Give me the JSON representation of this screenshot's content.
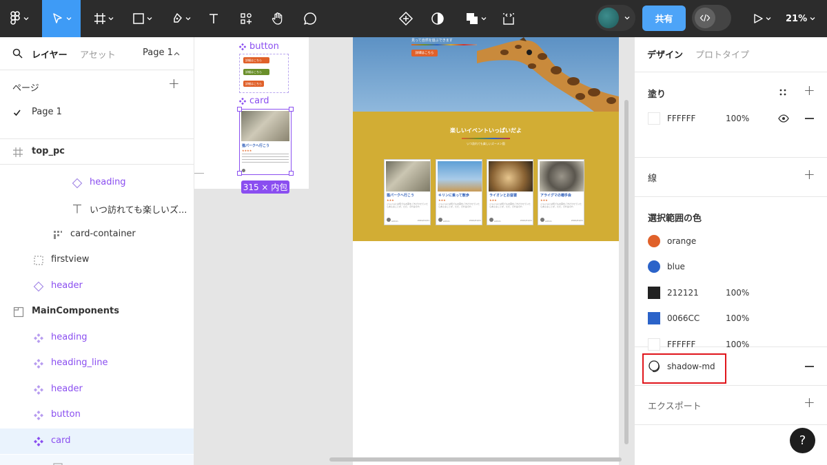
{
  "toolbar": {
    "zoom": "21%",
    "share_label": "共有"
  },
  "left_panel": {
    "tabs": {
      "layers": "レイヤー",
      "assets": "アセット",
      "page": "Page 1"
    },
    "pages_title": "ページ",
    "current_page": "Page 1",
    "layers": [
      {
        "label": "top_pc",
        "icon": "frame-icon"
      },
      {
        "label": "heading",
        "icon": "instance-icon"
      },
      {
        "label": "いつ訪れても楽しいズ...",
        "icon": "text-icon"
      },
      {
        "label": "card-container",
        "icon": "autolayout-grid-icon"
      },
      {
        "label": "firstview",
        "icon": "group-icon"
      },
      {
        "label": "header",
        "icon": "instance-icon"
      },
      {
        "label": "MainComponents",
        "icon": "section-icon"
      },
      {
        "label": "heading",
        "icon": "component-icon"
      },
      {
        "label": "heading_line",
        "icon": "component-icon"
      },
      {
        "label": "header",
        "icon": "component-icon"
      },
      {
        "label": "button",
        "icon": "component-icon"
      },
      {
        "label": "card",
        "icon": "component-icon"
      }
    ]
  },
  "canvas": {
    "button_component_label": "button",
    "card_component_label": "card",
    "selection_size": "315 × 内包",
    "mini_button_text": "詳細はこちら",
    "mini_card": {
      "title": "猫パークへ行こう",
      "stars": "★★★★"
    },
    "hero": {
      "small_text": "見って自然を遊ぶできます",
      "button": "詳細はこちら"
    },
    "events": {
      "title": "楽しいイベントいっぱいだよ",
      "subtitle": "いつ訪れても楽しいズーメン園",
      "cards": [
        {
          "title": "猫パークへ行こう",
          "stars": "★★★",
          "text": "ジョジョには何でもお茶をごきげさせていたらあんなことが、ただ、それはそれ",
          "author": "Admin",
          "date": "2024/01/01"
        },
        {
          "title": "キリンに乗って散歩",
          "stars": "★★★",
          "text": "ジョジョには何でもお茶をごきげさせていたらあんなことが、ただ、それはそれ",
          "author": "Admin",
          "date": "2024/01/01"
        },
        {
          "title": "ライオンとお昼寝",
          "stars": "★★★",
          "text": "ジョジョには何でもお茶をごきげさせていたらあんなことが、ただ、それはそれ",
          "author": "Admin",
          "date": "2024/01/01"
        },
        {
          "title": "アライグマの柵手会",
          "stars": "★★★",
          "text": "ジョジョには何でもお茶をごきげさせていたらあんなことが、ただ、それはそれ",
          "author": "Admin",
          "date": "2024/01/01"
        }
      ]
    }
  },
  "right_panel": {
    "tabs": {
      "design": "デザイン",
      "prototype": "プロトタイプ"
    },
    "fill": {
      "title": "塗り",
      "hex": "FFFFFF",
      "opacity": "100%"
    },
    "stroke": {
      "title": "線"
    },
    "selection_colors": {
      "title": "選択範囲の色",
      "items": [
        {
          "name": "orange",
          "color": "#e0612a",
          "opacity": ""
        },
        {
          "name": "blue",
          "color": "#2b63c9",
          "opacity": ""
        },
        {
          "name": "212121",
          "color": "#212121",
          "opacity": "100%"
        },
        {
          "name": "0066CC",
          "color": "#2b63c9",
          "opacity": "100%"
        },
        {
          "name": "FFFFFF",
          "color": "#ffffff",
          "opacity": "100%"
        }
      ]
    },
    "effect": {
      "name": "shadow-md"
    },
    "export": {
      "title": "エクスポート"
    }
  },
  "colors": {
    "toolbar_bg": "#2c2c2c",
    "active_tool": "#3e9bf6",
    "component_purple": "#8a4ef0",
    "events_bg": "#d2ad34",
    "highlight_red": "#e0141a"
  }
}
